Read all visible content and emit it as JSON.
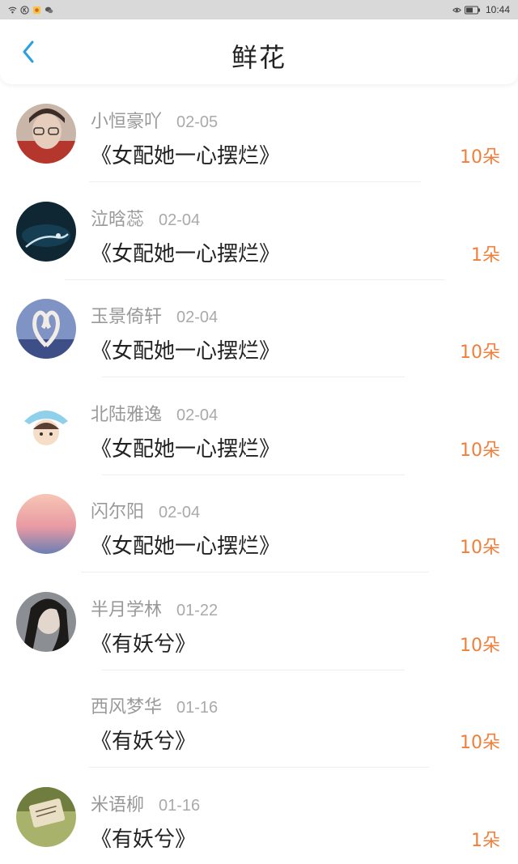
{
  "status_bar": {
    "time": "10:44",
    "left_icons": [
      "wifi-icon",
      "k-circle-icon",
      "app-icon",
      "wechat-icon"
    ],
    "right_icons": [
      "eye-icon",
      "battery-icon"
    ]
  },
  "header": {
    "back_icon": "chevron-left-icon",
    "title": "鲜花"
  },
  "colors": {
    "accent": "#2aa0e0",
    "count": "#ef7f3a",
    "name": "#999999",
    "text": "#222222"
  },
  "items": [
    {
      "name": "小恒豪吖",
      "date": "02-05",
      "book": "《女配她一心摆烂》",
      "count": "10朵"
    },
    {
      "name": "泣晗蕊",
      "date": "02-04",
      "book": "《女配她一心摆烂》",
      "count": "1朵"
    },
    {
      "name": "玉景倚轩",
      "date": "02-04",
      "book": "《女配她一心摆烂》",
      "count": "10朵"
    },
    {
      "name": "北陆雅逸",
      "date": "02-04",
      "book": "《女配她一心摆烂》",
      "count": "10朵"
    },
    {
      "name": "闪尔阳",
      "date": "02-04",
      "book": "《女配她一心摆烂》",
      "count": "10朵"
    },
    {
      "name": "半月学林",
      "date": "01-22",
      "book": "《有妖兮》",
      "count": "10朵"
    },
    {
      "name": "西风梦华",
      "date": "01-16",
      "book": "《有妖兮》",
      "count": "10朵"
    },
    {
      "name": "米语柳",
      "date": "01-16",
      "book": "《有妖兮》",
      "count": "1朵"
    }
  ]
}
